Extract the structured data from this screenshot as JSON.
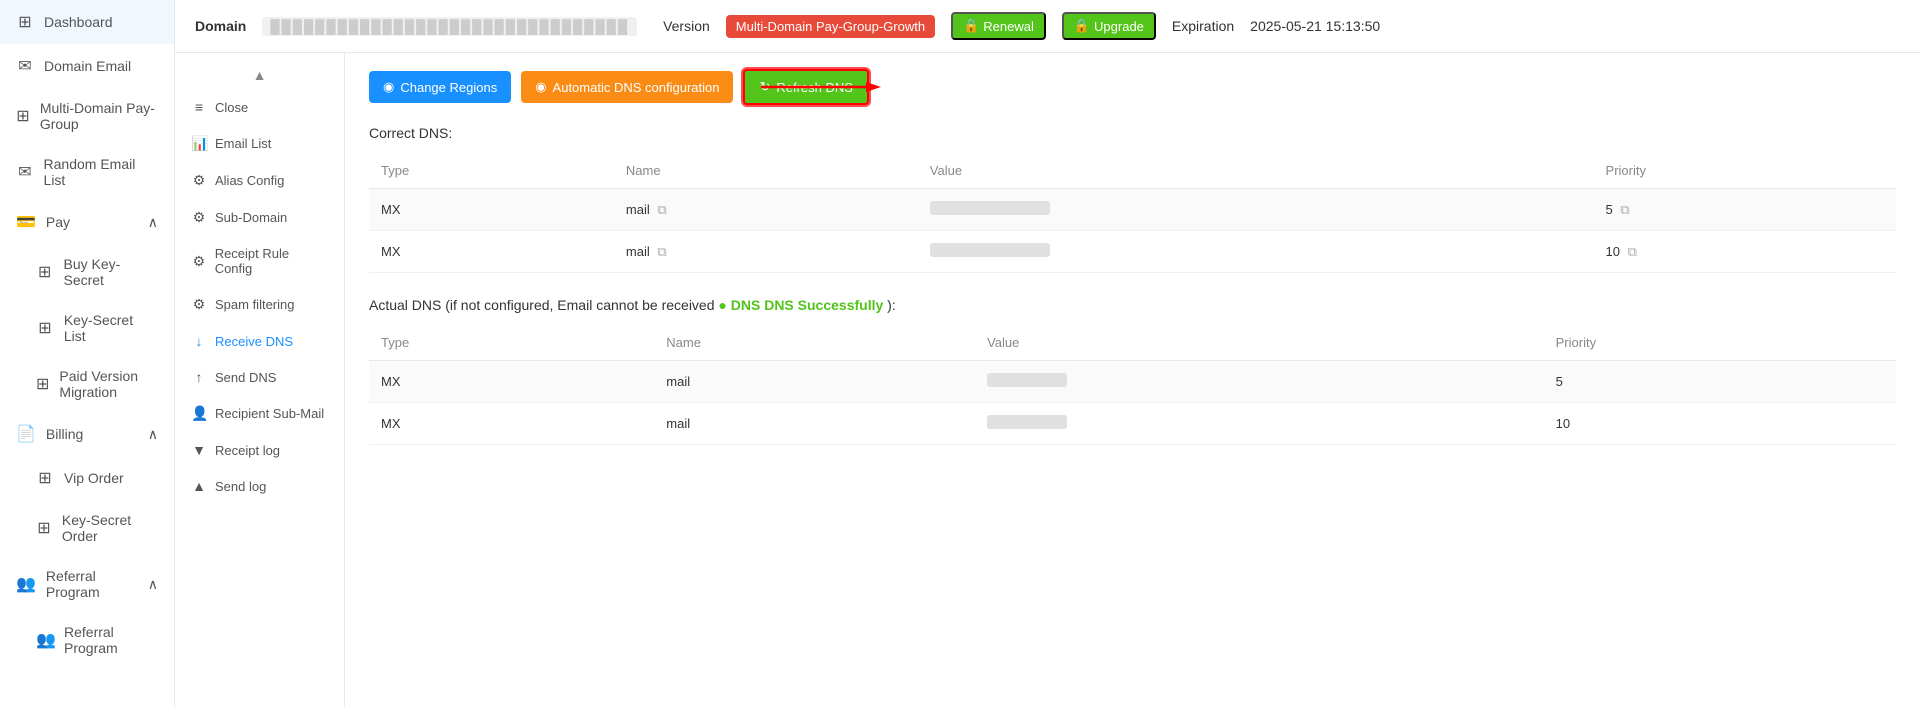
{
  "sidebar": {
    "items": [
      {
        "id": "dashboard",
        "label": "Dashboard",
        "icon": "⊞"
      },
      {
        "id": "domain-email",
        "label": "Domain Email",
        "icon": "✉"
      },
      {
        "id": "multi-domain",
        "label": "Multi-Domain Pay-Group",
        "icon": "⊞"
      },
      {
        "id": "random-email",
        "label": "Random Email List",
        "icon": "✉"
      },
      {
        "id": "pay",
        "label": "Pay",
        "icon": "💳",
        "expandable": true,
        "expanded": true
      },
      {
        "id": "buy-key-secret",
        "label": "Buy Key-Secret",
        "icon": "⊞",
        "sub": true
      },
      {
        "id": "key-secret-list",
        "label": "Key-Secret List",
        "icon": "⊞",
        "sub": true
      },
      {
        "id": "paid-version-migration",
        "label": "Paid Version Migration",
        "icon": "⊞",
        "sub": true
      },
      {
        "id": "billing",
        "label": "Billing",
        "icon": "📄",
        "expandable": true,
        "expanded": true
      },
      {
        "id": "vip-order",
        "label": "Vip Order",
        "icon": "⊞",
        "sub": true
      },
      {
        "id": "key-secret-order",
        "label": "Key-Secret Order",
        "icon": "⊞",
        "sub": true
      },
      {
        "id": "referral-program",
        "label": "Referral Program",
        "icon": "👥",
        "expandable": true,
        "expanded": true
      },
      {
        "id": "referral-program-item",
        "label": "Referral Program",
        "icon": "👥",
        "sub": true
      }
    ]
  },
  "topbar": {
    "domain_label": "Domain",
    "domain_value": "██████████████████████████████",
    "version_label": "Version",
    "version_badge": "Multi-Domain Pay-Group-Growth",
    "renewal_label": "Renewal",
    "upgrade_label": "Upgrade",
    "expiration_label": "Expiration",
    "expiration_value": "2025-05-21 15:13:50"
  },
  "submenu": {
    "items": [
      {
        "id": "close",
        "label": "Close",
        "icon": "≡"
      },
      {
        "id": "email-list",
        "label": "Email List",
        "icon": "📊"
      },
      {
        "id": "alias-config",
        "label": "Alias Config",
        "icon": "⚙"
      },
      {
        "id": "sub-domain",
        "label": "Sub-Domain",
        "icon": "⚙"
      },
      {
        "id": "receipt-rule-config",
        "label": "Receipt Rule Config",
        "icon": "⚙"
      },
      {
        "id": "spam-filtering",
        "label": "Spam filtering",
        "icon": "⚙"
      },
      {
        "id": "receive-dns",
        "label": "Receive DNS",
        "icon": "↓",
        "active": true
      },
      {
        "id": "send-dns",
        "label": "Send DNS",
        "icon": "↑"
      },
      {
        "id": "recipient-sub-mail",
        "label": "Recipient Sub-Mail",
        "icon": "👤"
      },
      {
        "id": "receipt-log",
        "label": "Receipt log",
        "icon": "▼"
      },
      {
        "id": "send-log",
        "label": "Send log",
        "icon": "▲"
      }
    ]
  },
  "main": {
    "buttons": {
      "change_regions": "Change Regions",
      "automatic_dns": "Automatic DNS configuration",
      "refresh_dns": "Refresh DNS"
    },
    "correct_dns_title": "Correct DNS:",
    "correct_dns_table": {
      "headers": [
        "Type",
        "Name",
        "Value",
        "Priority"
      ],
      "rows": [
        {
          "type": "MX",
          "name": "mail",
          "value": "████████████████████",
          "priority": "5"
        },
        {
          "type": "MX",
          "name": "mail",
          "value": "████████████████████",
          "priority": "10"
        }
      ]
    },
    "actual_dns_title": "Actual DNS (if not configured, Email cannot be received",
    "actual_dns_status": "DNS DNS Successfully",
    "actual_dns_table": {
      "headers": [
        "Type",
        "Name",
        "Value",
        "Priority"
      ],
      "rows": [
        {
          "type": "MX",
          "name": "mail",
          "value": "████████████",
          "priority": "5"
        },
        {
          "type": "MX",
          "name": "mail",
          "value": "████████████",
          "priority": "10"
        }
      ]
    }
  }
}
